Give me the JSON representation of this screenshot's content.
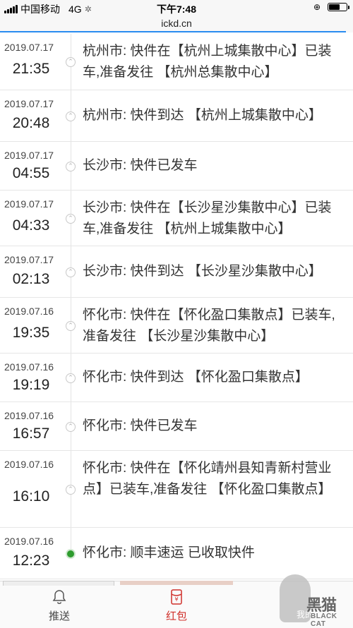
{
  "status_bar": {
    "carrier": "中国移动",
    "network": "4G",
    "time": "下午7:48"
  },
  "url_bar": {
    "domain": "ickd.cn",
    "load_progress_percent": 98
  },
  "tracking": [
    {
      "date": "2019.07.17",
      "time": "21:35",
      "text": "杭州市: 快件在【杭州上城集散中心】已装车,准备发往 【杭州总集散中心】",
      "current": false
    },
    {
      "date": "2019.07.17",
      "time": "20:48",
      "text": "杭州市: 快件到达 【杭州上城集散中心】",
      "current": false
    },
    {
      "date": "2019.07.17",
      "time": "04:55",
      "text": "长沙市: 快件已发车",
      "current": false
    },
    {
      "date": "2019.07.17",
      "time": "04:33",
      "text": "长沙市: 快件在【长沙星沙集散中心】已装车,准备发往 【杭州上城集散中心】",
      "current": false
    },
    {
      "date": "2019.07.17",
      "time": "02:13",
      "text": "长沙市: 快件到达 【长沙星沙集散中心】",
      "current": false
    },
    {
      "date": "2019.07.16",
      "time": "19:35",
      "text": "怀化市: 快件在【怀化盈口集散点】已装车,准备发往 【长沙星沙集散中心】",
      "current": false
    },
    {
      "date": "2019.07.16",
      "time": "19:19",
      "text": "怀化市: 快件到达 【怀化盈口集散点】",
      "current": false
    },
    {
      "date": "2019.07.16",
      "time": "16:57",
      "text": "怀化市: 快件已发车",
      "current": false
    },
    {
      "date": "2019.07.16",
      "time": "16:10",
      "text": "怀化市: 快件在【怀化靖州县知青新村营业点】已装车,准备发往 【怀化盈口集散点】",
      "current": false
    },
    {
      "date": "2019.07.16",
      "time": "12:23",
      "text": "怀化市: 顺丰速运 已收取快件",
      "current": true
    }
  ],
  "tab_bar": {
    "push_label": "推送",
    "redpacket_label": "红包",
    "redpacket_icon_glyph": "¥"
  },
  "watermark": {
    "small_text": "我的",
    "brand_text": "黑猫",
    "brand_latin": "BLACK CAT"
  },
  "colors": {
    "accent_red": "#d0302b",
    "progress_blue": "#2a8cf0",
    "active_dot": "#2e9c2e"
  }
}
